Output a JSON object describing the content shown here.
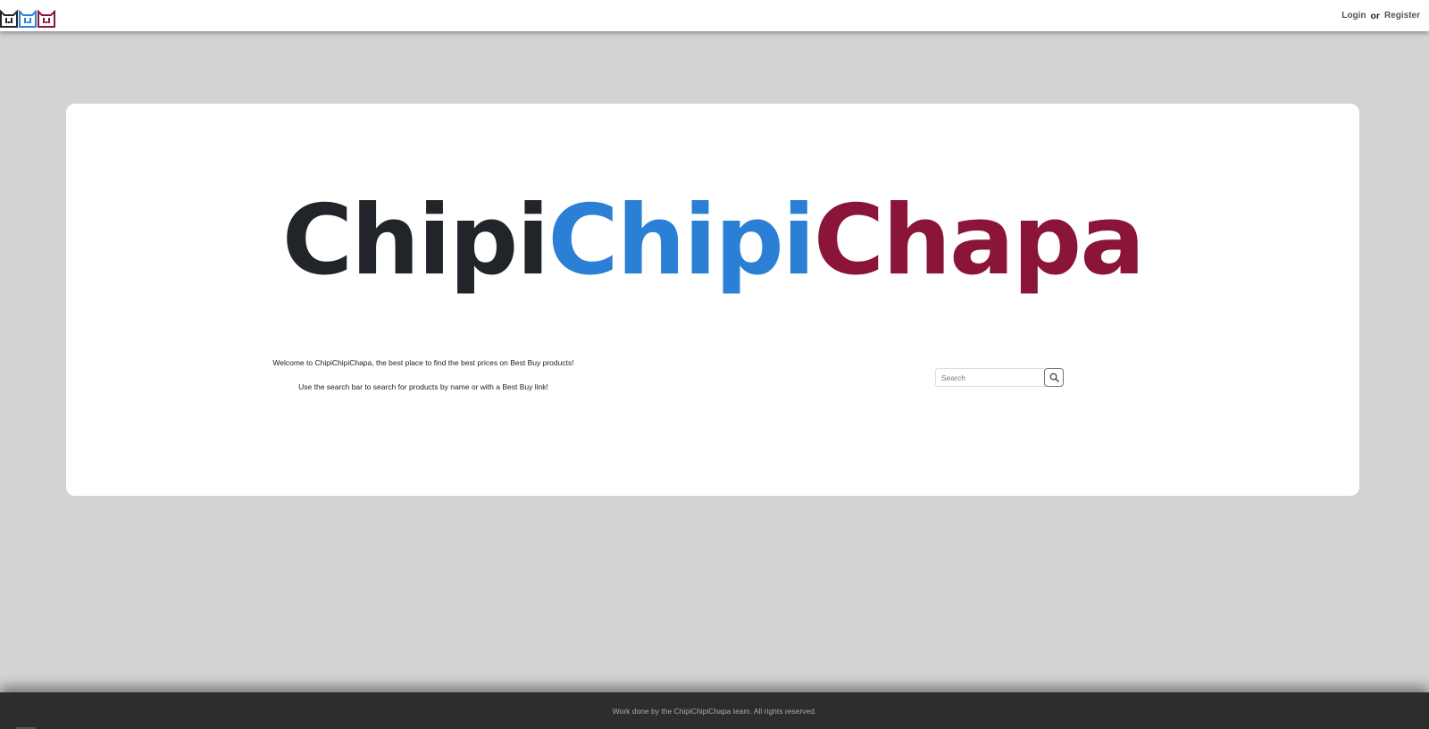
{
  "nav": {
    "login_label": "Login",
    "or_label": "or",
    "register_label": "Register"
  },
  "hero": {
    "part1": "Chipi",
    "part2": "Chipi",
    "part3": "Chapa",
    "colors": [
      "#212529",
      "#2b7fd4",
      "#8a1538"
    ]
  },
  "intro": {
    "line1": "Welcome to ChipiChipiChapa, the best place to find the best prices on Best Buy products!",
    "line2": "Use the search bar to search for products by name or with a Best Buy link!"
  },
  "search": {
    "placeholder": "Search",
    "icon": "search-icon"
  },
  "footer": {
    "text": "Work done by the ChipiChipiChapa team. All rights reserved."
  }
}
